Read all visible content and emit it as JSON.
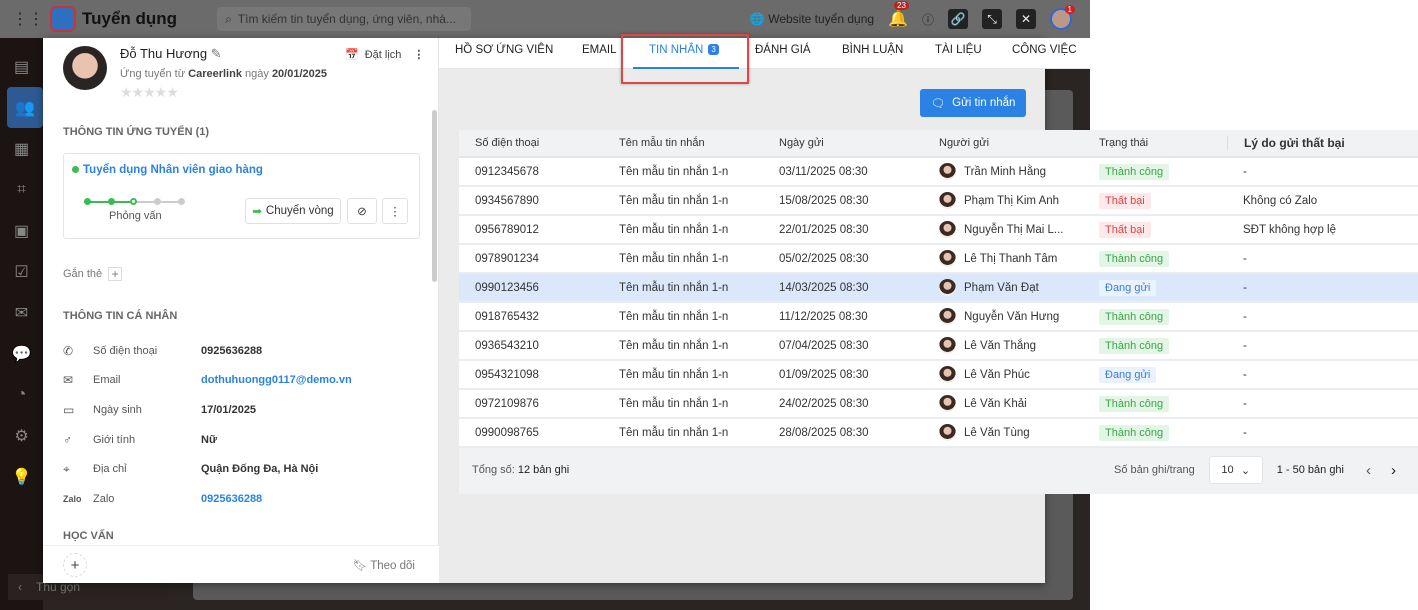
{
  "topbar": {
    "app_title": "Tuyển dụng",
    "search_placeholder": "Tìm kiếm tin tuyển dụng, ứng viên, nhà...",
    "website_link": "Website tuyển dụng",
    "notification_count": "23",
    "avatar_badge": "1"
  },
  "nav": {
    "collapse_label": "Thu gọn"
  },
  "candidate": {
    "name": "Đỗ Thu Hương",
    "applied_prefix": "Ứng tuyển từ",
    "source": "Careerlink",
    "date_prefix": "ngày",
    "applied_date": "20/01/2025",
    "schedule_label": "Đặt lịch",
    "rating": 0
  },
  "application": {
    "section_title": "THÔNG TIN ỨNG TUYỂN (1)",
    "job": "Tuyển dụng Nhân viên giao hàng",
    "stage": "Phỏng vấn",
    "move_label": "Chuyển vòng"
  },
  "tags_label": "Gắn thẻ",
  "personal": {
    "section_title": "THÔNG TIN CÁ NHÂN",
    "rows": [
      {
        "label": "Số điện thoại",
        "value": "0925636288"
      },
      {
        "label": "Email",
        "value": "dothuhuongg0117@demo.vn"
      },
      {
        "label": "Ngày sinh",
        "value": "17/01/2025"
      },
      {
        "label": "Giới tính",
        "value": "Nữ"
      },
      {
        "label": "Địa chỉ",
        "value": "Quận Đống Đa, Hà Nội"
      },
      {
        "label": "Zalo",
        "value": "0925636288"
      }
    ]
  },
  "education_title": "HỌC VẤN",
  "follow_label": "Theo dõi",
  "tabs": [
    {
      "label": "HỒ SƠ ỨNG VIÊN"
    },
    {
      "label": "EMAIL"
    },
    {
      "label": "TIN NHẮN",
      "badge": "3"
    },
    {
      "label": "ĐÁNH GIÁ"
    },
    {
      "label": "BÌNH LUẬN"
    },
    {
      "label": "TÀI LIỆU"
    },
    {
      "label": "CÔNG VIỆC"
    }
  ],
  "send_label": "Gửi tin nhắn",
  "table": {
    "headers": [
      "Số điện thoại",
      "Tên mẫu tin nhắn",
      "Ngày gửi",
      "Người gửi",
      "Trạng thái",
      "Lý do gửi thất bại"
    ],
    "rows": [
      [
        "0912345678",
        "Tên mẫu tin nhắn 1-n",
        "03/11/2025 08:30",
        "Trần Minh Hằng",
        "Thành công",
        "-"
      ],
      [
        "0934567890",
        "Tên mẫu tin nhắn 1-n",
        "15/08/2025 08:30",
        "Phạm Thị Kim Anh",
        "Thất bại",
        "Không có Zalo"
      ],
      [
        "0956789012",
        "Tên mẫu tin nhắn 1-n",
        "22/01/2025 08:30",
        "Nguyễn Thị Mai L...",
        "Thất bại",
        "SĐT không hợp lệ"
      ],
      [
        "0978901234",
        "Tên mẫu tin nhắn 1-n",
        "05/02/2025 08:30",
        "Lê Thị Thanh Tâm",
        "Thành công",
        "-"
      ],
      [
        "0990123456",
        "Tên mẫu tin nhắn 1-n",
        "14/03/2025 08:30",
        "Phạm Văn Đạt",
        "Đang gửi",
        "-"
      ],
      [
        "0918765432",
        "Tên mẫu tin nhắn 1-n",
        "11/12/2025 08:30",
        "Nguyễn Văn Hưng",
        "Thành công",
        "-"
      ],
      [
        "0936543210",
        "Tên mẫu tin nhắn 1-n",
        "07/04/2025 08:30",
        "Lê Văn Thắng",
        "Thành công",
        "-"
      ],
      [
        "0954321098",
        "Tên mẫu tin nhắn 1-n",
        "01/09/2025 08:30",
        "Lê Văn Phúc",
        "Đang gửi",
        "-"
      ],
      [
        "0972109876",
        "Tên mẫu tin nhắn 1-n",
        "24/02/2025 08:30",
        "Lê Văn Khải",
        "Thành công",
        "-"
      ],
      [
        "0990098765",
        "Tên mẫu tin nhắn 1-n",
        "28/08/2025 08:30",
        "Lê Văn Tùng",
        "Thành công",
        "-"
      ]
    ],
    "selected_row": 4
  },
  "footer": {
    "total_prefix": "Tổng số:",
    "total": "12 bản ghi",
    "per_page_label": "Số bản ghi/trang",
    "per_page": "10",
    "range": "1 - 50 bản ghi"
  },
  "colors": {
    "accent": "#2b82e4",
    "success": "#3aa54a",
    "fail": "#e14444",
    "highlight": "#e04646"
  }
}
